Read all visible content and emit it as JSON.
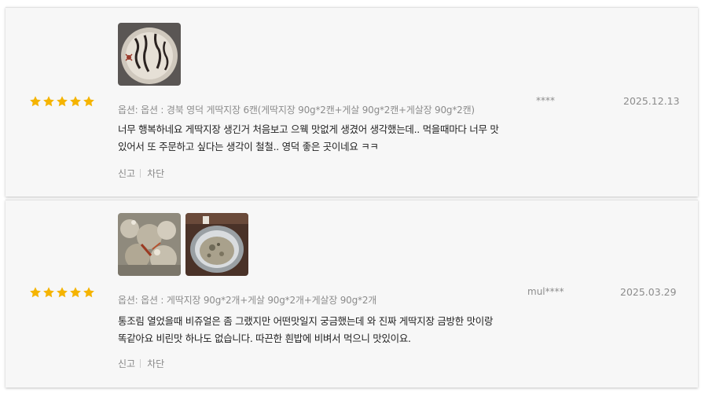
{
  "colors": {
    "star": "#f5b400",
    "card_bg": "#f7f7f7",
    "muted_text": "#8c8c8c",
    "body_text": "#222222"
  },
  "reviews": [
    {
      "rating": 5,
      "rating_max": 5,
      "photos": [
        "jar-lid-handwritten-label-photo"
      ],
      "option": "옵션: 옵션 : 경북 영덕 게딱지장 6캔(게딱지장 90g*2캔+게살 90g*2캔+게살장 90g*2캔)",
      "content": "너무 행복하네요 게딱지장 생긴거 처음보고 으웩 맛없게 생겼어 생각했는데.. 먹을때마다 너무 맛있어서 또 주문하고 싶다는 생각이 철철.. 영덕 좋은 곳이네요 ㅋㅋ",
      "author": "****",
      "date": "2025.12.13",
      "report_label": "신고",
      "block_label": "차단"
    },
    {
      "rating": 5,
      "rating_max": 5,
      "photos": [
        "crab-meat-closeup-photo",
        "open-can-photo"
      ],
      "option": "옵션: 옵션 : 게딱지장 90g*2개+게살 90g*2개+게살장 90g*2개",
      "content": "통조림 열었을때 비쥬얼은 좀 그랬지만 어떤맛일지 궁금했는데 와 진짜 게딱지장 금방한 맛이랑 똑같아요 비린맛 하나도 없습니다. 따끈한 흰밥에 비벼서 먹으니 맛있이요.",
      "author": "mul****",
      "date": "2025.03.29",
      "report_label": "신고",
      "block_label": "차단"
    }
  ]
}
